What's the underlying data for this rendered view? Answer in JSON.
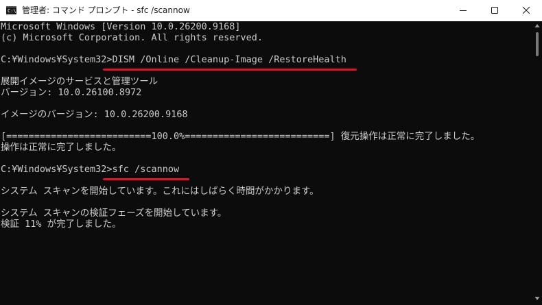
{
  "window": {
    "title": "管理者: コマンド プロンプト - sfc  /scannow",
    "icon_name": "cmd-icon",
    "icon_glyph": "C:\\",
    "controls": {
      "minimize_icon": "minimize-icon",
      "maximize_icon": "maximize-icon",
      "close_icon": "close-icon"
    }
  },
  "console": {
    "lines": [
      "Microsoft Windows [Version 10.0.26200.9168]",
      "(c) Microsoft Corporation. All rights reserved.",
      "",
      "C:¥Windows¥System32>DISM /Online /Cleanup-Image /RestoreHealth",
      "",
      "展開イメージのサービスと管理ツール",
      "バージョン: 10.0.26100.8972",
      "",
      "イメージのバージョン: 10.0.26200.9168",
      "",
      "[==========================100.0%==========================] 復元操作は正常に完了しました。",
      "操作は正常に完了しました。",
      "",
      "C:¥Windows¥System32>sfc /scannow",
      "",
      "システム スキャンを開始しています。これにはしばらく時間がかかります。",
      "",
      "システム スキャンの検証フェーズを開始しています。",
      "検証 11% が完了しました。"
    ],
    "highlight_color": "#e81123",
    "text_color": "#cccccc",
    "background_color": "#0c0c0c"
  }
}
